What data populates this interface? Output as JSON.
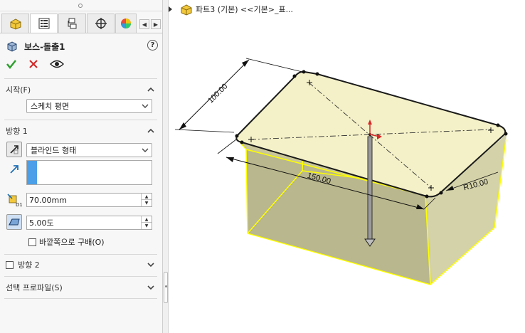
{
  "panel": {
    "tabs": [
      "feature-manager",
      "property-manager",
      "configuration-manager",
      "dimxpert-manager",
      "display-manager"
    ],
    "feature_title": "보스-돌출1",
    "help_label": "?",
    "actions": [
      "ok-icon",
      "cancel-icon",
      "preview-icon"
    ],
    "from_section": {
      "label": "시작(F)",
      "value": "스케치 평면"
    },
    "direction1": {
      "label": "방향 1",
      "end_condition": "블라인드 형태",
      "depth": "70.00mm",
      "draft_angle": "5.00도",
      "draft_outward_label": "바깥쪽으로 구배(O)"
    },
    "direction2": {
      "label": "방향 2"
    },
    "selected_contours": {
      "label": "선택 프로파일(S)"
    }
  },
  "breadcrumb": {
    "text": "파트3 (기본) <<기본>_표..."
  },
  "viewport": {
    "dimensions": {
      "length": "150.00",
      "width": "100.00",
      "radius": "R10.00"
    },
    "colors": {
      "top_face": "#f4f1c8",
      "side_face": "#c8c69a",
      "edge_highlight": "#ffff00",
      "outline": "#1a1a1a"
    }
  }
}
